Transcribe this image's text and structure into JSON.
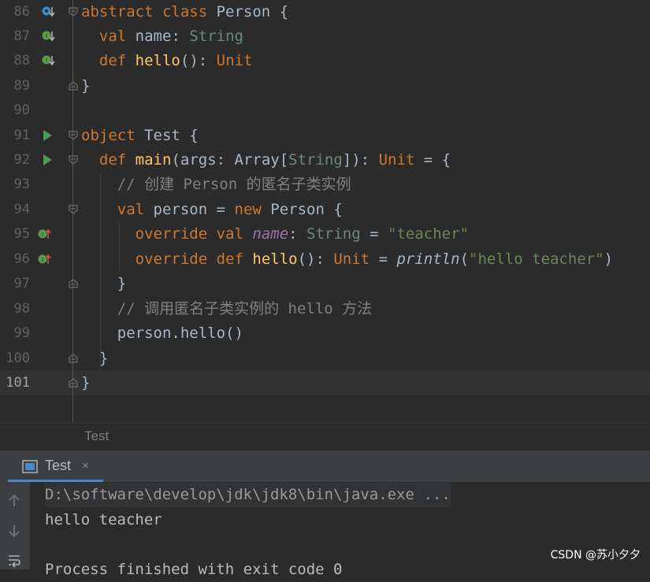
{
  "editor": {
    "lines": [
      {
        "n": "86",
        "gicon": "implemented-down",
        "fold": "open"
      },
      {
        "n": "87",
        "gicon": "implemented-down-i",
        "fold": ""
      },
      {
        "n": "88",
        "gicon": "implemented-down-i",
        "fold": ""
      },
      {
        "n": "89",
        "gicon": "",
        "fold": "close"
      },
      {
        "n": "90",
        "gicon": "",
        "fold": ""
      },
      {
        "n": "91",
        "gicon": "run",
        "fold": "open"
      },
      {
        "n": "92",
        "gicon": "run",
        "fold": "open"
      },
      {
        "n": "93",
        "gicon": "",
        "fold": ""
      },
      {
        "n": "94",
        "gicon": "",
        "fold": "open"
      },
      {
        "n": "95",
        "gicon": "override-up",
        "fold": ""
      },
      {
        "n": "96",
        "gicon": "override-up",
        "fold": ""
      },
      {
        "n": "97",
        "gicon": "",
        "fold": "close"
      },
      {
        "n": "98",
        "gicon": "",
        "fold": ""
      },
      {
        "n": "99",
        "gicon": "",
        "fold": ""
      },
      {
        "n": "100",
        "gicon": "",
        "fold": "close"
      },
      {
        "n": "101",
        "gicon": "",
        "fold": "close"
      }
    ],
    "code": {
      "l86_kw": "abstract class",
      "l86_name": "Person",
      "l86_brace": "{",
      "l87_kw": "val",
      "l87_name": "name",
      "l87_colon": ":",
      "l87_type": "String",
      "l88_kw": "def",
      "l88_fn": "hello",
      "l88_paren": "():",
      "l88_type": "Unit",
      "l89": "}",
      "l91_kw": "object",
      "l91_name": "Test",
      "l91_brace": "{",
      "l92_kw": "def",
      "l92_fn": "main",
      "l92_args": "(args: Array[",
      "l92_type": "String",
      "l92_close": "]):",
      "l92_unit": "Unit",
      "l92_eq": "= {",
      "l93_comment": "// 创建 Person 的匿名子类实例",
      "l94_kw": "val",
      "l94_var": "person =",
      "l94_new": "new",
      "l94_rest": "Person {",
      "l95_kw": "override val",
      "l95_field": "name",
      "l95_colon": ":",
      "l95_type": "String",
      "l95_eq": "=",
      "l95_str": "\"teacher\"",
      "l96_kw": "override def",
      "l96_fn": "hello",
      "l96_paren": "():",
      "l96_unit": "Unit",
      "l96_eq": "=",
      "l96_call": "println",
      "l96_open": "(",
      "l96_str": "\"hello teacher\"",
      "l96_close": ")",
      "l97": "}",
      "l98_comment": "// 调用匿名子类实例的 hello 方法",
      "l99": "person.hello()",
      "l100": "}",
      "l101": "}"
    }
  },
  "breadcrumb": {
    "label": "Test"
  },
  "run_panel": {
    "tab_label": "Test",
    "tab_close": "×",
    "console_lines": [
      "D:\\software\\develop\\jdk\\jdk8\\bin\\java.exe ...",
      "hello teacher",
      "",
      "Process finished with exit code 0"
    ]
  },
  "watermark": "CSDN @苏小夕夕",
  "colors": {
    "background": "#2b2b2b",
    "keyword": "#cc7832",
    "function": "#ffc66d",
    "string": "#6a8759",
    "comment": "#808080",
    "field": "#9876aa",
    "run_icon": "#499c54",
    "accent": "#4a88c7"
  }
}
